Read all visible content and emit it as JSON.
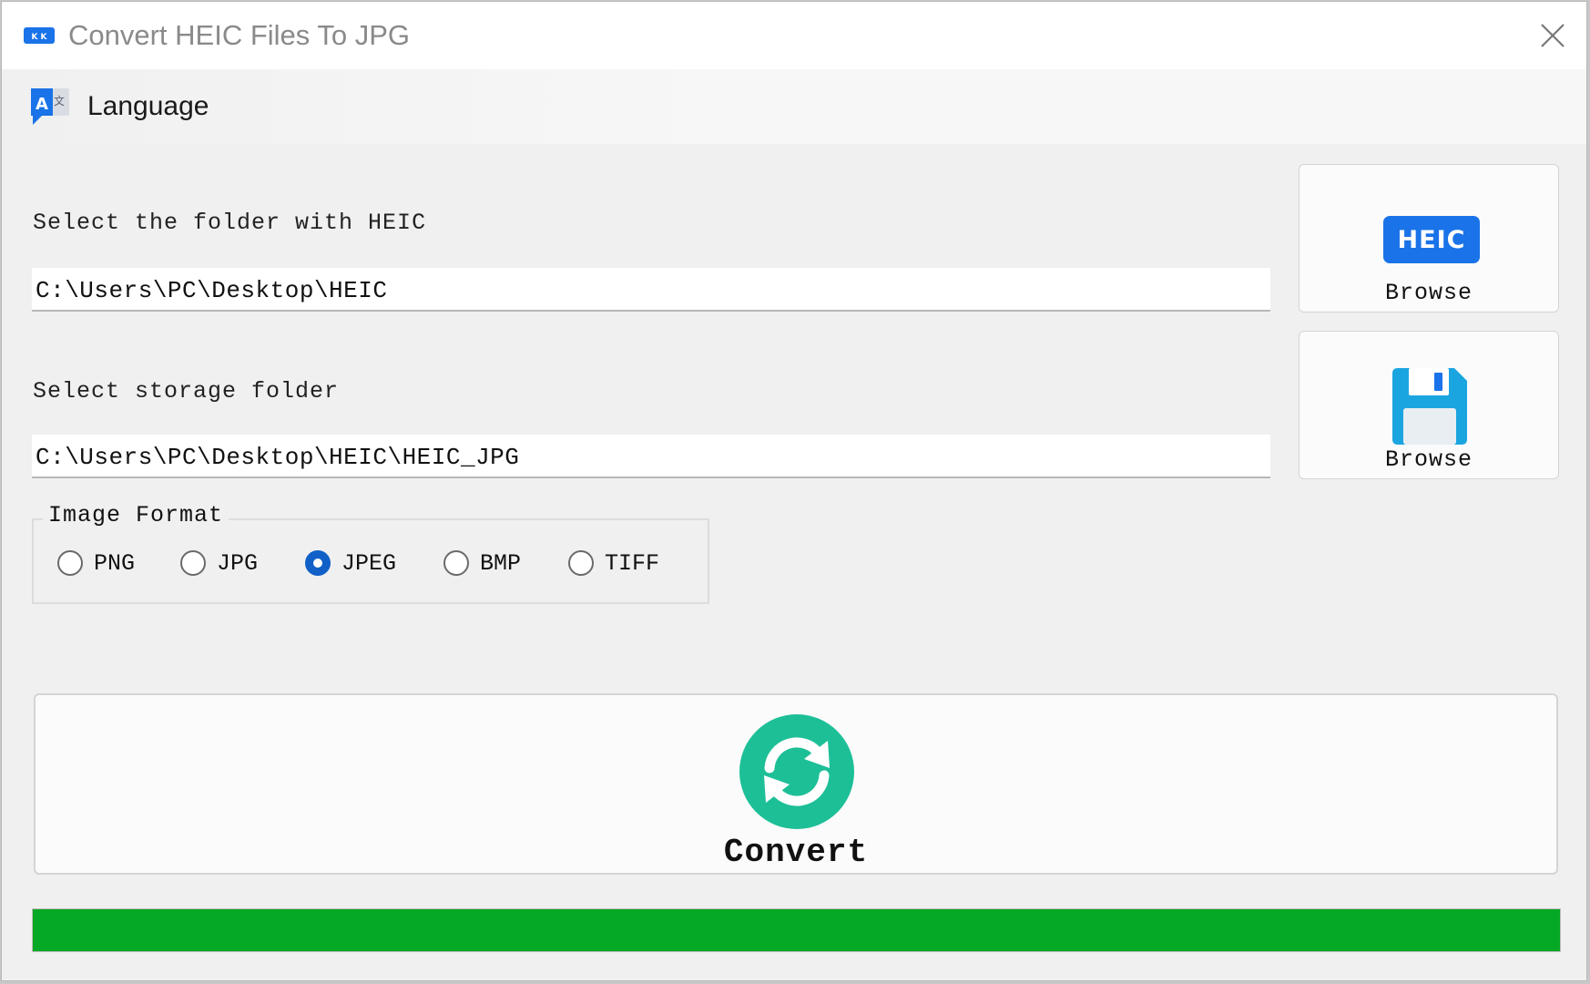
{
  "window": {
    "title": "Convert HEIC Files To JPG",
    "app_icon": "app-logo-icon",
    "close_icon": "close-icon"
  },
  "menu": {
    "language_label": "Language",
    "language_icon": "translate-icon"
  },
  "source": {
    "label": "Select the folder with HEIC",
    "path": "C:\\Users\\PC\\Desktop\\HEIC",
    "browse_label": "Browse",
    "browse_badge": "HEIC"
  },
  "storage": {
    "label": "Select storage folder",
    "path": "C:\\Users\\PC\\Desktop\\HEIC\\HEIC_JPG",
    "browse_label": "Browse",
    "browse_icon": "floppy-disk-icon"
  },
  "image_format": {
    "legend": "Image Format",
    "options": [
      "PNG",
      "JPG",
      "JPEG",
      "BMP",
      "TIFF"
    ],
    "selected": "JPEG"
  },
  "convert": {
    "label": "Convert",
    "icon": "refresh-icon"
  },
  "progress": {
    "percent": 100
  },
  "colors": {
    "progress_fill": "#06a925",
    "convert_icon": "#1dbf97",
    "heic_badge": "#1a73e8",
    "radio_checked": "#1060c8"
  }
}
